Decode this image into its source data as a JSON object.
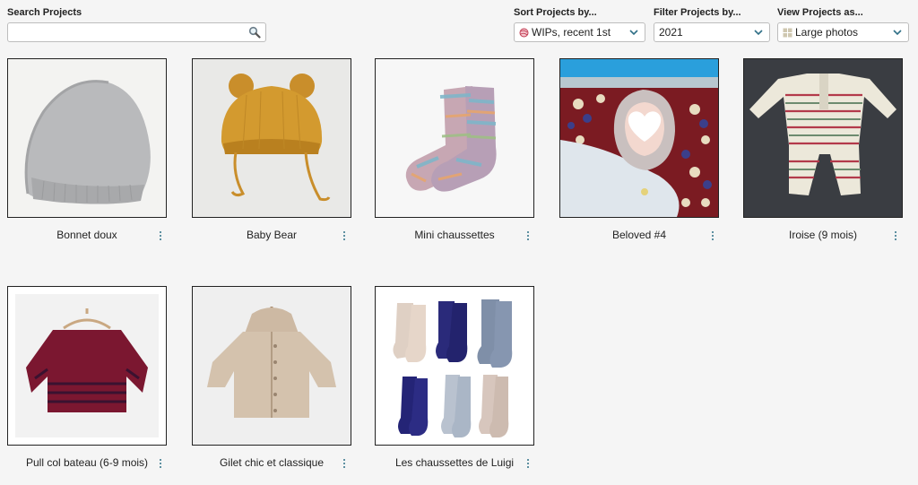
{
  "search": {
    "label": "Search Projects",
    "value": "",
    "placeholder": ""
  },
  "sort": {
    "label": "Sort Projects by...",
    "selected": "WIPs, recent 1st"
  },
  "filter": {
    "label": "Filter Projects by...",
    "selected": "2021"
  },
  "view": {
    "label": "View Projects as...",
    "selected": "Large photos"
  },
  "projects": [
    {
      "name": "Bonnet doux",
      "photo": "grey knit beanie"
    },
    {
      "name": "Baby Bear",
      "photo": "mustard bear-ear bonnet"
    },
    {
      "name": "Mini chaussettes",
      "photo": "multicolor baby socks"
    },
    {
      "name": "Beloved #4",
      "photo": "baby in knitted hood"
    },
    {
      "name": "Iroise (9 mois)",
      "photo": "striped knit romper"
    },
    {
      "name": "Pull col bateau (6-9 mois)",
      "photo": "burgundy striped sweater"
    },
    {
      "name": "Gilet chic et classique",
      "photo": "beige hooded cardigan"
    },
    {
      "name": "Les chaussettes de Luigi",
      "photo": "six pairs of socks"
    }
  ],
  "colors": {
    "accent": "#2f6f86",
    "border": "#222222",
    "background": "#f5f5f5"
  }
}
